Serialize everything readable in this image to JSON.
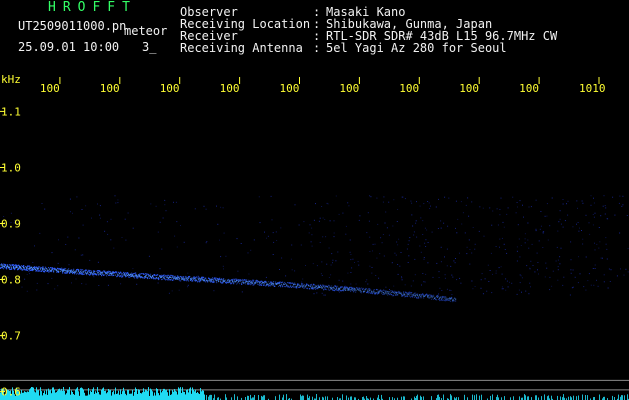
{
  "header": {
    "app_name": "HROFFT",
    "file_name": "UT2509011000.pn",
    "mode_label": "meteor",
    "datetime": "25.09.01 10:00",
    "counter": "3_",
    "info": [
      {
        "label": "Observer",
        "value": "Masaki Kano"
      },
      {
        "label": "Receiving Location",
        "value": "Shibukawa, Gunma, Japan"
      },
      {
        "label": "Receiver",
        "value": "RTL-SDR SDR# 43dB L15 96.7MHz CW"
      },
      {
        "label": "Receiving Antenna",
        "value": "5el Yagi Az 280 for Seoul"
      }
    ],
    "separator": ":"
  },
  "colors": {
    "background": "#000000",
    "header_text": "#f2f2f2",
    "app_title": "#33ff66",
    "axis_text": "#ffff33",
    "echo": "#2f5bff",
    "echo_core": "#4d8cff",
    "noise_band": "#22e6ff",
    "grid": "#8a8a8a",
    "speckle": "#1a2aa0"
  },
  "chart_data": {
    "type": "heatmap",
    "ylabel": "kHz",
    "yticks": [
      {
        "value": 1.1,
        "label": "1.1"
      },
      {
        "value": 1.0,
        "label": "1.0"
      },
      {
        "value": 0.9,
        "label": "0.9"
      },
      {
        "value": 0.8,
        "label": "0.8"
      },
      {
        "value": 0.7,
        "label": "0.7"
      },
      {
        "value": 0.6,
        "label": "0.6"
      }
    ],
    "xticks": [
      {
        "value": 1,
        "label": "100"
      },
      {
        "value": 2,
        "label": "100"
      },
      {
        "value": 3,
        "label": "100"
      },
      {
        "value": 4,
        "label": "100"
      },
      {
        "value": 5,
        "label": "100"
      },
      {
        "value": 6,
        "label": "100"
      },
      {
        "value": 7,
        "label": "100"
      },
      {
        "value": 8,
        "label": "100"
      },
      {
        "value": 9,
        "label": "100"
      },
      {
        "value": 10,
        "label": "1010"
      }
    ],
    "xlim": [
      0,
      10.5
    ],
    "ylim": [
      0.585,
      1.165
    ],
    "grid": false,
    "echo_trace": {
      "x": [
        0,
        1,
        2,
        3,
        4,
        5,
        6,
        7,
        7.6
      ],
      "y": [
        0.825,
        0.817,
        0.81,
        0.803,
        0.797,
        0.79,
        0.782,
        0.772,
        0.765
      ]
    },
    "reference_lines": [
      0.62,
      0.603
    ]
  }
}
